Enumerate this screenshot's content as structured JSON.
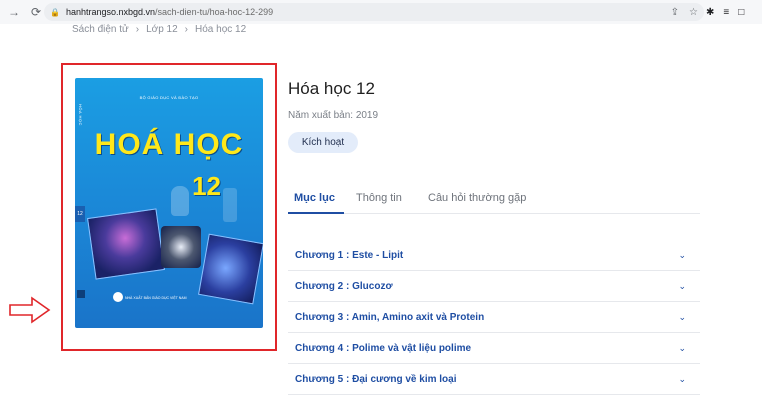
{
  "browser": {
    "url_domain": "hanhtrangso.nxbgd.vn",
    "url_path": "/sach-dien-tu/hoa-hoc-12-299",
    "icons": [
      "back-arrow-icon",
      "reload-icon",
      "lock-icon",
      "share-icon",
      "star-icon",
      "extensions-icon",
      "media-icon",
      "sidepanel-icon"
    ]
  },
  "breadcrumb": {
    "items": [
      "Sách điện tử",
      "Lớp 12",
      "Hóa học 12"
    ],
    "separator": "›"
  },
  "cover": {
    "publisher_top": "BỘ GIÁO DỤC VÀ ĐÀO TẠO",
    "vertical_label": "HÓA HỌC",
    "title": "HOÁ HỌC",
    "grade": "12",
    "side_tag": "12",
    "publisher_bottom": "NHÀ XUẤT BẢN GIÁO DỤC VIỆT NAM"
  },
  "book": {
    "title": "Hóa học 12",
    "pub_year": "Năm xuất bản: 2019",
    "activate_label": "Kích hoạt"
  },
  "tabs": [
    "Mục lục",
    "Thông tin",
    "Câu hỏi thường gặp"
  ],
  "chapters": [
    "Chương 1 :  Este - Lipit",
    "Chương 2 :  Glucozơ",
    "Chương 3 :  Amin, Amino axit và Protein",
    "Chương 4 :  Polime và vật liệu polime",
    "Chương 5 :  Đại cương về kim loại"
  ],
  "colors": {
    "accent": "#1f4ea3",
    "highlight_border": "#e0262a",
    "cover_blue": "#1b9ee3",
    "cover_title": "#ffe81a"
  }
}
